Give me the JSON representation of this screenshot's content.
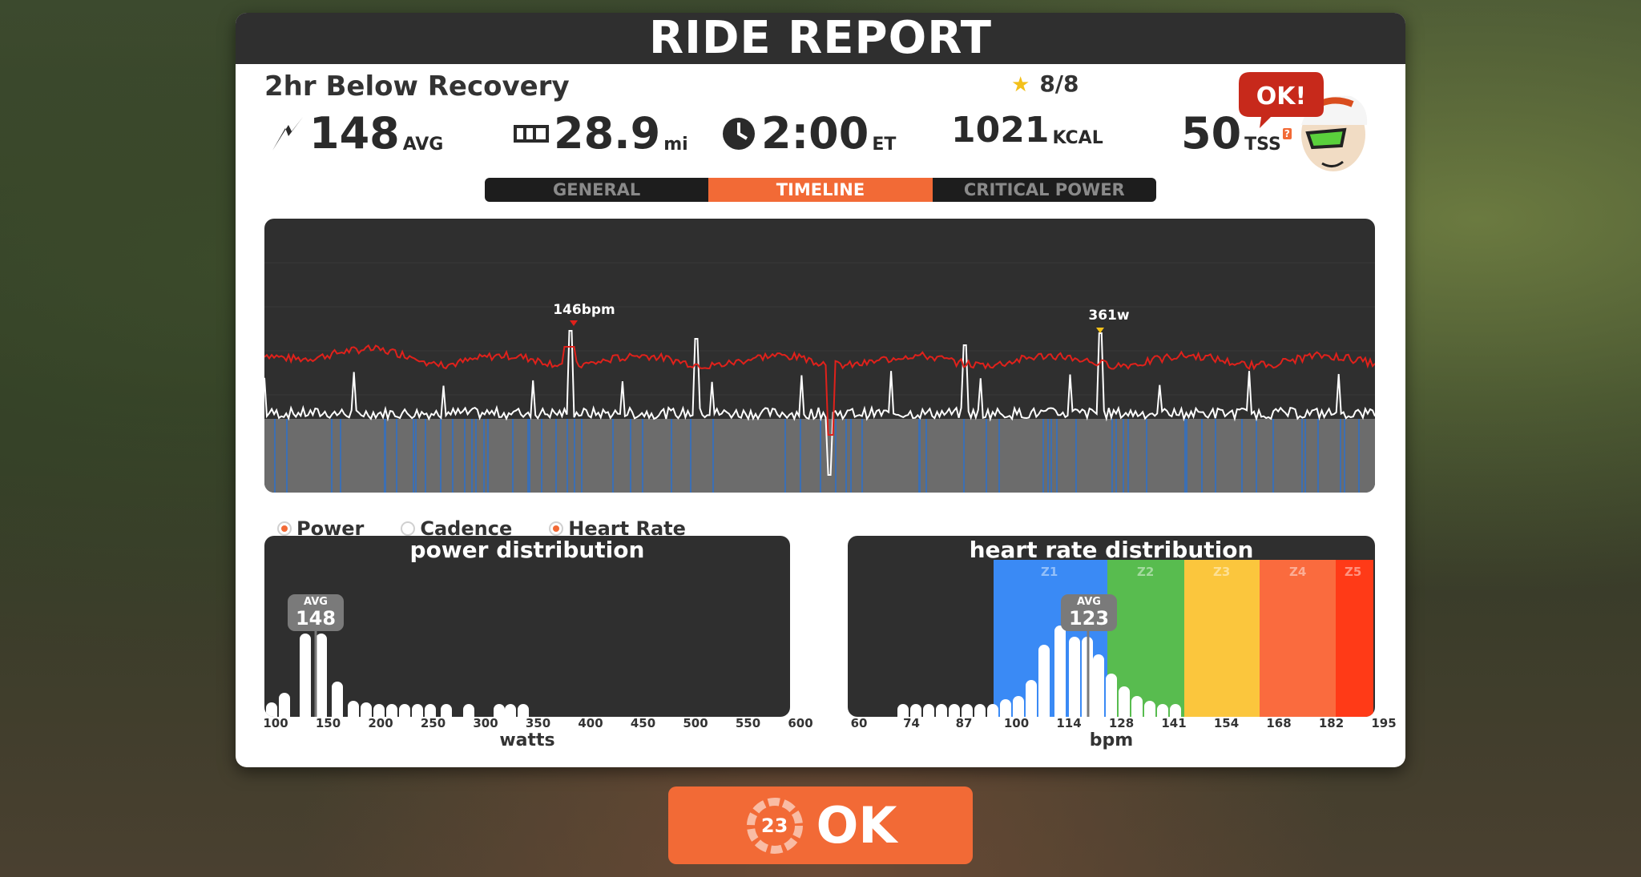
{
  "header": {
    "title": "RIDE REPORT"
  },
  "workout": {
    "name": "2hr Below Recovery",
    "rating": "8/8"
  },
  "stats": {
    "power": {
      "value": "148",
      "unit": "AVG"
    },
    "distance": {
      "value": "28.9",
      "unit": "mi"
    },
    "time": {
      "value": "2:00",
      "unit": "ET"
    },
    "calories": {
      "value": "1021",
      "unit": "KCAL"
    },
    "tss": {
      "value": "50",
      "unit": "TSS",
      "help": "?"
    }
  },
  "mascot": {
    "speech": "OK!"
  },
  "tabs": [
    {
      "label": "GENERAL",
      "active": false
    },
    {
      "label": "TIMELINE",
      "active": true
    },
    {
      "label": "CRITICAL POWER",
      "active": false
    }
  ],
  "timeline": {
    "hr_peak_label": "146bpm",
    "power_peak_label": "361w"
  },
  "legend": [
    {
      "label": "Power",
      "selected": true
    },
    {
      "label": "Cadence",
      "selected": false
    },
    {
      "label": "Heart Rate",
      "selected": true
    }
  ],
  "power_dist": {
    "title": "power distribution",
    "ticks": [
      "100",
      "150",
      "200",
      "250",
      "300",
      "350",
      "400",
      "450",
      "500",
      "550",
      "600"
    ],
    "xlabel": "watts",
    "avg_label": "AVG",
    "avg_value": "148"
  },
  "hr_dist": {
    "title": "heart rate distribution",
    "ticks": [
      "60",
      "74",
      "87",
      "100",
      "114",
      "128",
      "141",
      "154",
      "168",
      "182",
      "195"
    ],
    "xlabel": "bpm",
    "zones": [
      "Z1",
      "Z2",
      "Z3",
      "Z4",
      "Z5"
    ],
    "avg_label": "AVG",
    "avg_value": "123"
  },
  "ok_button": {
    "label": "OK",
    "countdown": "23"
  },
  "colors": {
    "accent": "#f26a36",
    "heart_rate": "#e0211b",
    "panel_dark": "#2f2f2f"
  }
}
